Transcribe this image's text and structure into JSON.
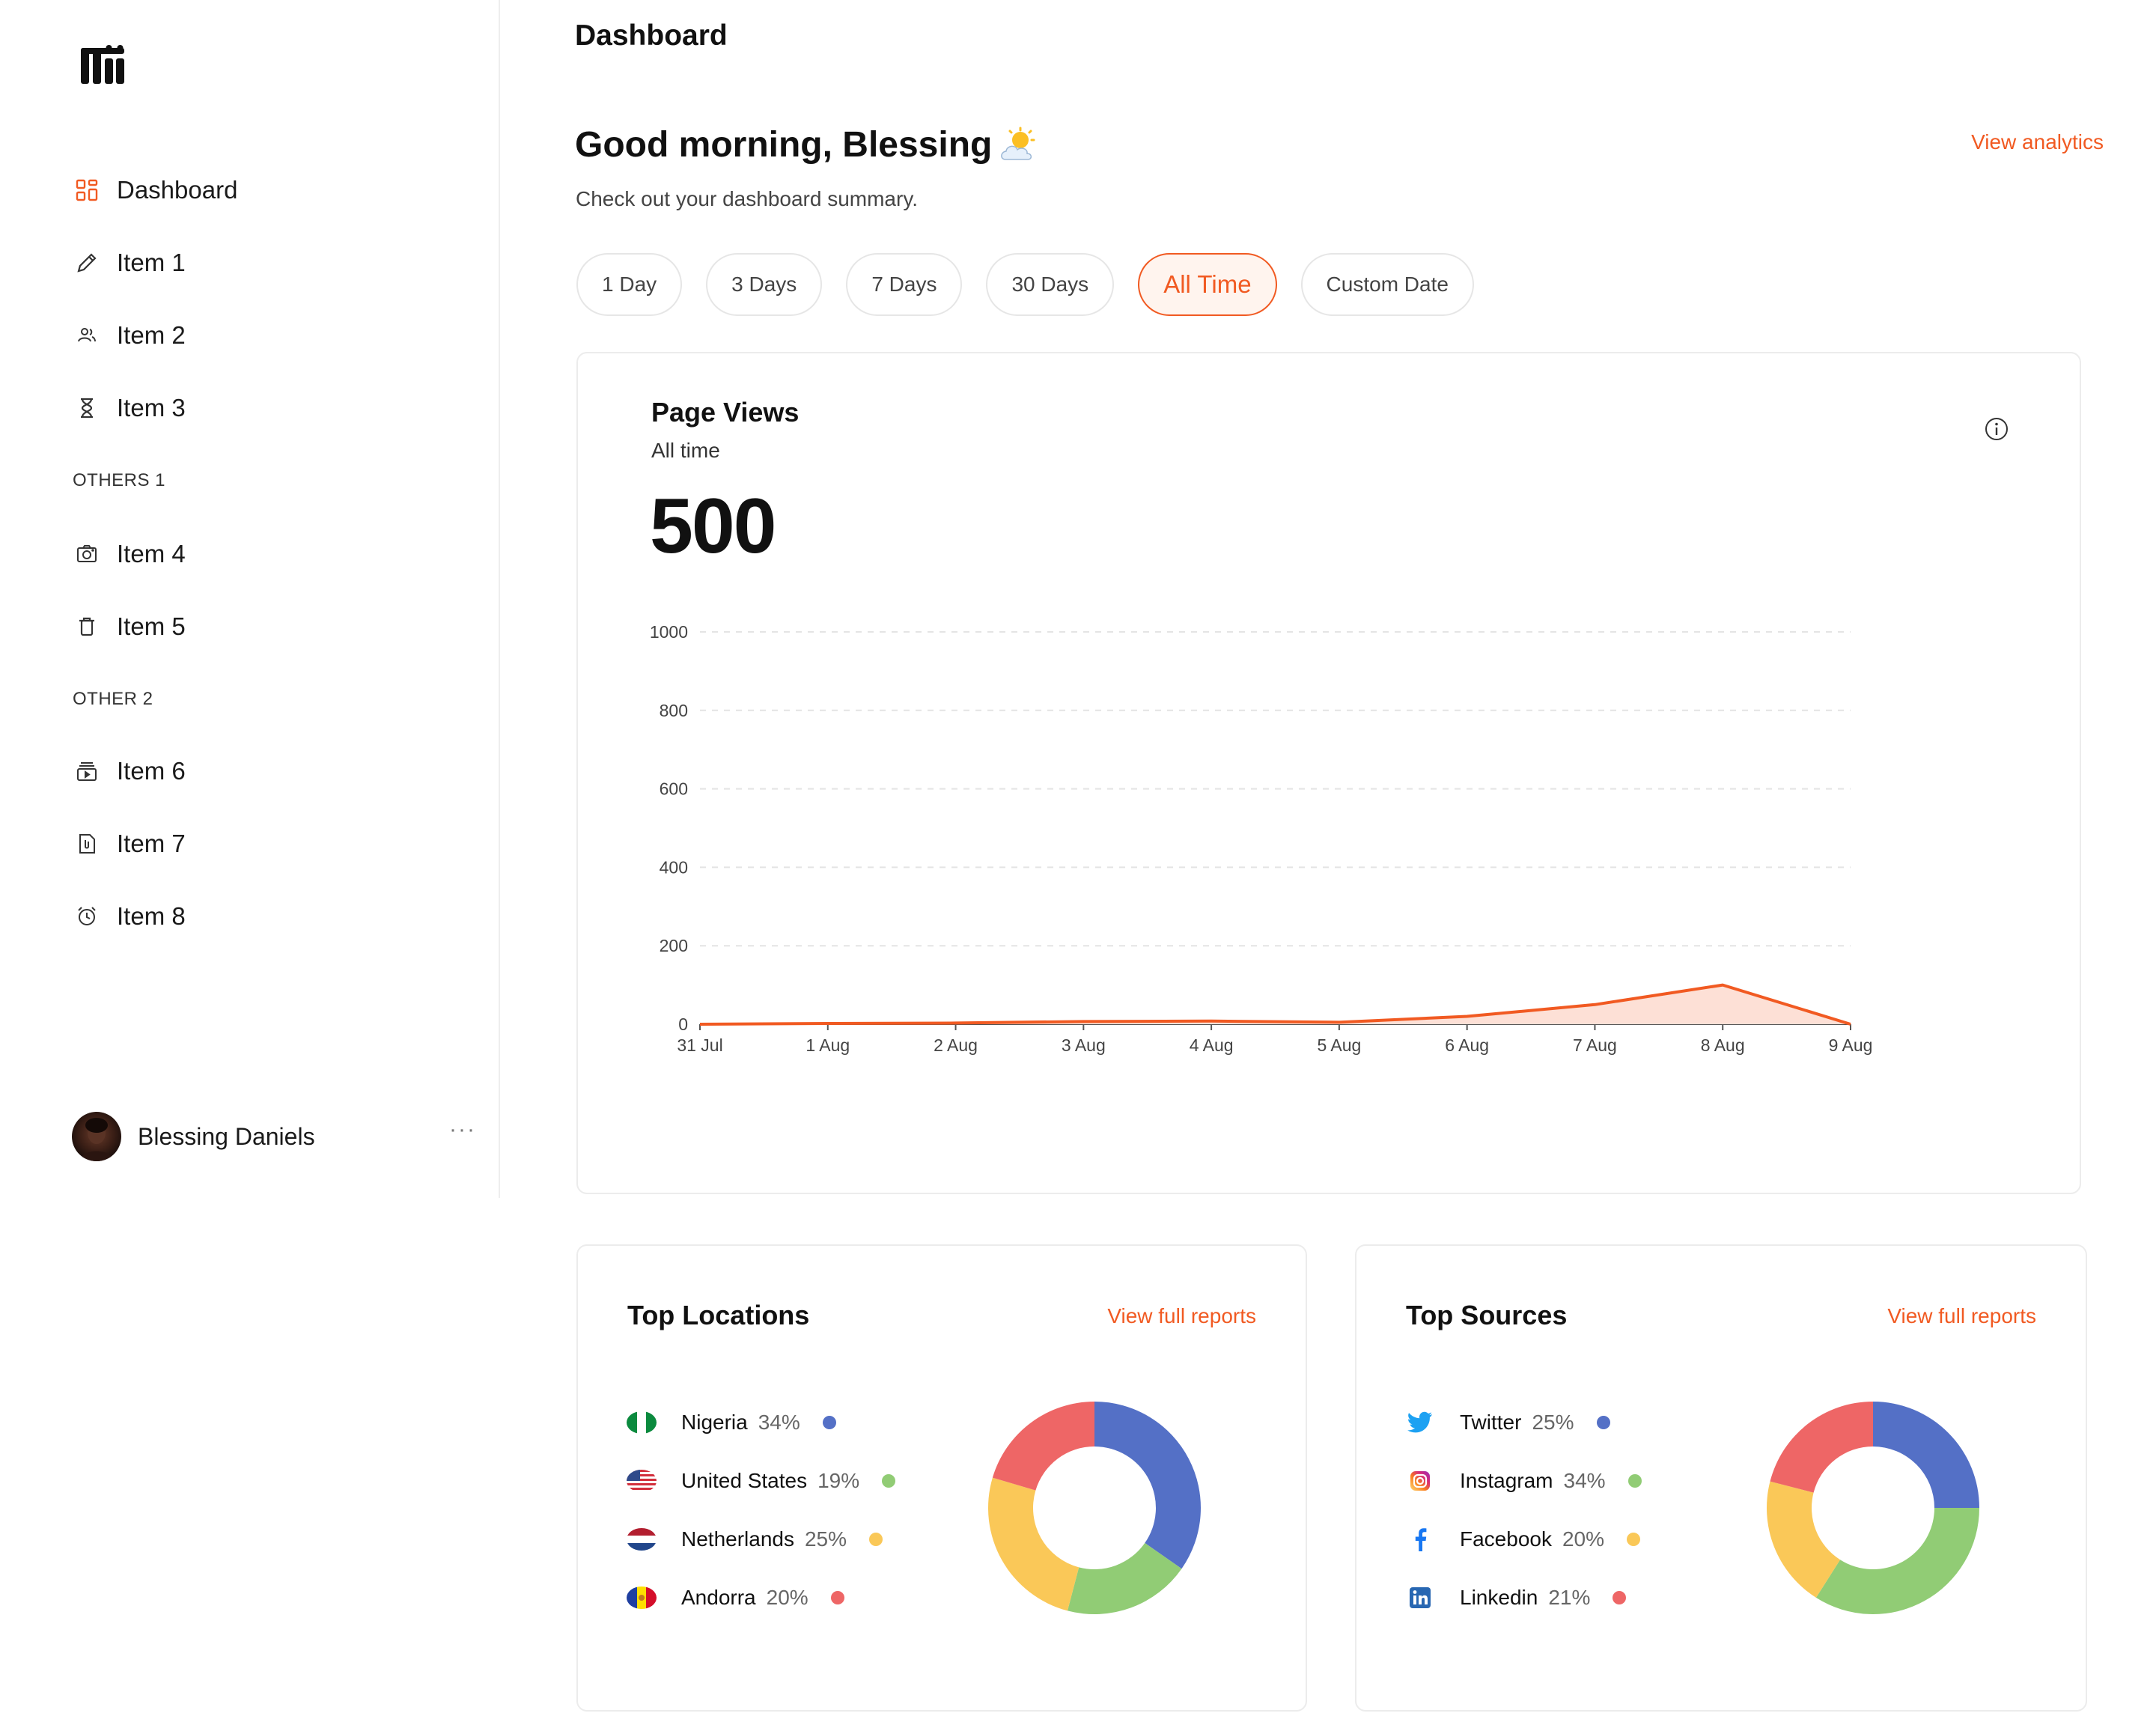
{
  "header": {
    "title": "Dashboard"
  },
  "sidebar": {
    "items": [
      {
        "label": "Dashboard",
        "icon": "dashboard-grid-icon",
        "active": true
      },
      {
        "label": "Item 1",
        "icon": "pencil-icon"
      },
      {
        "label": "Item 2",
        "icon": "users-icon"
      },
      {
        "label": "Item 3",
        "icon": "hourglass-icon"
      },
      {
        "label": "Item 4",
        "icon": "camera-icon"
      },
      {
        "label": "Item 5",
        "icon": "trash-icon"
      },
      {
        "label": "Item 6",
        "icon": "video-library-icon"
      },
      {
        "label": "Item 7",
        "icon": "file-attachment-icon"
      },
      {
        "label": "Item 8",
        "icon": "alarm-clock-icon"
      }
    ],
    "sections": [
      "OTHERS 1",
      "OTHER 2"
    ],
    "user": {
      "name": "Blessing Daniels",
      "more": "···"
    }
  },
  "greeting": {
    "title": "Good morning, Blessing",
    "subtitle": "Check out your dashboard summary.",
    "view_analytics": "View analytics"
  },
  "filters": [
    {
      "label": "1 Day"
    },
    {
      "label": "3 Days"
    },
    {
      "label": "7 Days"
    },
    {
      "label": "30 Days"
    },
    {
      "label": "All Time",
      "active": true
    },
    {
      "label": "Custom Date"
    }
  ],
  "page_views": {
    "title": "Page Views",
    "subtitle": "All time",
    "value": "500"
  },
  "chart_data": {
    "type": "area",
    "x": [
      "31 Jul",
      "1 Aug",
      "2 Aug",
      "3 Aug",
      "4 Aug",
      "5 Aug",
      "6 Aug",
      "7 Aug",
      "8 Aug",
      "9 Aug"
    ],
    "series": [
      {
        "values": [
          0,
          2,
          3,
          7,
          8,
          5,
          20,
          50,
          100,
          0
        ]
      }
    ],
    "yticks": [
      "0",
      "200",
      "400",
      "600",
      "800",
      "1000"
    ],
    "ylim": [
      0,
      1000
    ],
    "grid": true,
    "line_color": "#f15a22",
    "fill_color": "#fde0d6"
  },
  "top_locations": {
    "title": "Top Locations",
    "link": "View full reports",
    "items": [
      {
        "name": "Nigeria",
        "pct": "34%",
        "value": 34,
        "color": "#5470c6",
        "icon": "nigeria-flag-icon"
      },
      {
        "name": "United States",
        "pct": "19%",
        "value": 19,
        "color": "#91cc75",
        "icon": "usa-flag-icon"
      },
      {
        "name": "Netherlands",
        "pct": "25%",
        "value": 25,
        "color": "#fac858",
        "icon": "netherlands-flag-icon"
      },
      {
        "name": "Andorra",
        "pct": "20%",
        "value": 20,
        "color": "#ee6666",
        "icon": "andorra-flag-icon"
      }
    ]
  },
  "top_sources": {
    "title": "Top Sources",
    "link": "View full reports",
    "items": [
      {
        "name": "Twitter",
        "pct": "25%",
        "value": 25,
        "color": "#5470c6",
        "icon": "twitter-icon"
      },
      {
        "name": "Instagram",
        "pct": "34%",
        "value": 34,
        "color": "#91cc75",
        "icon": "instagram-icon"
      },
      {
        "name": "Facebook",
        "pct": "20%",
        "value": 20,
        "color": "#fac858",
        "icon": "facebook-icon"
      },
      {
        "name": "Linkedin",
        "pct": "21%",
        "value": 21,
        "color": "#ee6666",
        "icon": "linkedin-icon"
      }
    ]
  }
}
